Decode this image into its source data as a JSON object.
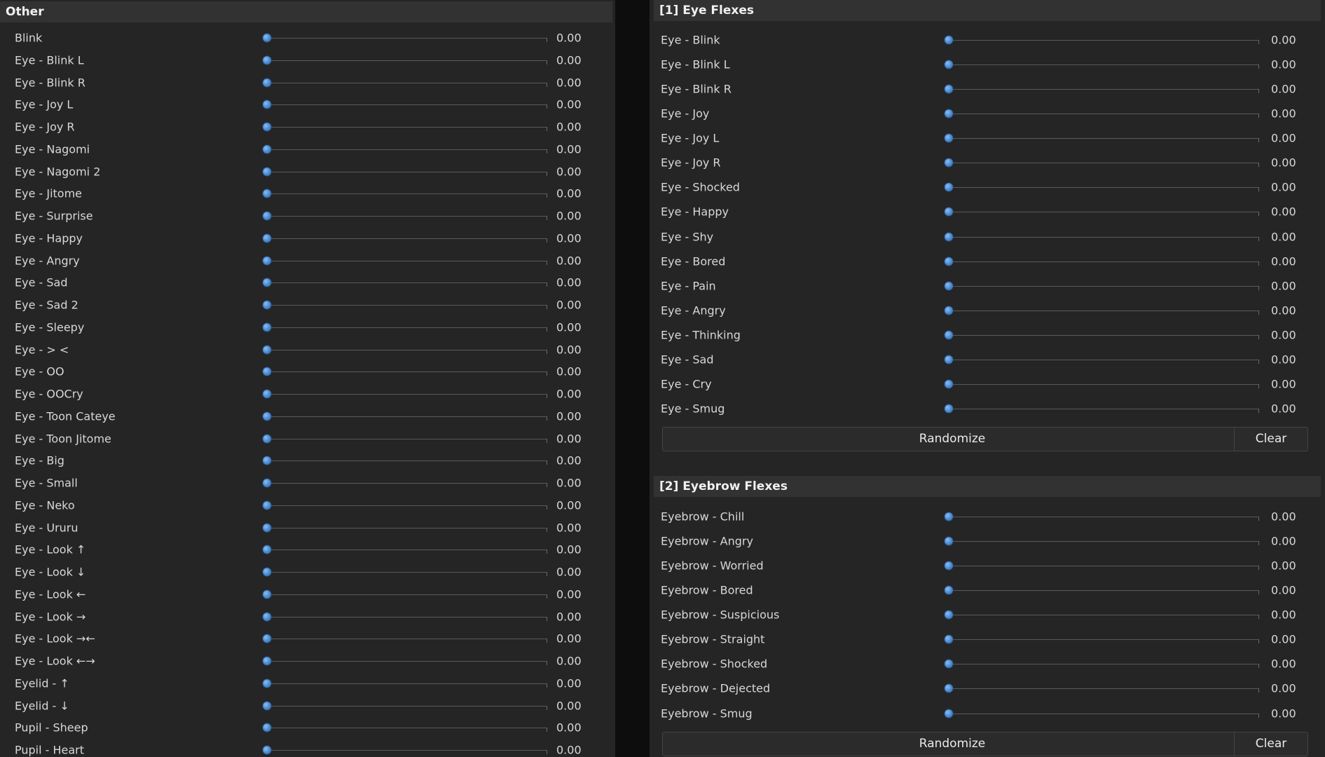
{
  "other": {
    "title": "Other",
    "sliders": [
      {
        "label": "Blink",
        "value": "0.00",
        "level": 0
      },
      {
        "label": "Eye - Blink L",
        "value": "0.00",
        "level": 0
      },
      {
        "label": "Eye - Blink R",
        "value": "0.00",
        "level": 0
      },
      {
        "label": "Eye - Joy L",
        "value": "0.00",
        "level": 0
      },
      {
        "label": "Eye - Joy R",
        "value": "0.00",
        "level": 0
      },
      {
        "label": "Eye - Nagomi",
        "value": "0.00",
        "level": 0
      },
      {
        "label": "Eye - Nagomi 2",
        "value": "0.00",
        "level": 0
      },
      {
        "label": "Eye - Jitome",
        "value": "0.00",
        "level": 0
      },
      {
        "label": "Eye - Surprise",
        "value": "0.00",
        "level": 0
      },
      {
        "label": "Eye - Happy",
        "value": "0.00",
        "level": 0
      },
      {
        "label": "Eye - Angry",
        "value": "0.00",
        "level": 0
      },
      {
        "label": "Eye - Sad",
        "value": "0.00",
        "level": 0
      },
      {
        "label": "Eye - Sad 2",
        "value": "0.00",
        "level": 0
      },
      {
        "label": "Eye - Sleepy",
        "value": "0.00",
        "level": 0
      },
      {
        "label": "Eye - > <",
        "value": "0.00",
        "level": 0
      },
      {
        "label": "Eye - OO",
        "value": "0.00",
        "level": 0
      },
      {
        "label": "Eye - OOCry",
        "value": "0.00",
        "level": 0
      },
      {
        "label": "Eye - Toon Cateye",
        "value": "0.00",
        "level": 0
      },
      {
        "label": "Eye - Toon Jitome",
        "value": "0.00",
        "level": 0
      },
      {
        "label": "Eye - Big",
        "value": "0.00",
        "level": 0
      },
      {
        "label": "Eye - Small",
        "value": "0.00",
        "level": 0
      },
      {
        "label": "Eye - Neko",
        "value": "0.00",
        "level": 0
      },
      {
        "label": "Eye - Ururu",
        "value": "0.00",
        "level": 0
      },
      {
        "label": "Eye - Look ↑",
        "value": "0.00",
        "level": 0
      },
      {
        "label": "Eye - Look ↓",
        "value": "0.00",
        "level": 0
      },
      {
        "label": "Eye - Look ←",
        "value": "0.00",
        "level": 0
      },
      {
        "label": "Eye - Look →",
        "value": "0.00",
        "level": 0
      },
      {
        "label": "Eye - Look →←",
        "value": "0.00",
        "level": 0
      },
      {
        "label": "Eye - Look ←→",
        "value": "0.00",
        "level": 0
      },
      {
        "label": "Eyelid - ↑",
        "value": "0.00",
        "level": 0
      },
      {
        "label": "Eyelid - ↓",
        "value": "0.00",
        "level": 0
      },
      {
        "label": "Pupil - Sheep",
        "value": "0.00",
        "level": 0
      },
      {
        "label": "Pupil - Heart",
        "value": "0.00",
        "level": 0
      }
    ]
  },
  "eye_flexes": {
    "title": "[1] Eye Flexes",
    "sliders": [
      {
        "label": "Eye - Blink",
        "value": "0.00",
        "level": 0
      },
      {
        "label": "Eye - Blink L",
        "value": "0.00",
        "level": 0
      },
      {
        "label": "Eye - Blink R",
        "value": "0.00",
        "level": 0
      },
      {
        "label": "Eye - Joy",
        "value": "0.00",
        "level": 0
      },
      {
        "label": "Eye - Joy L",
        "value": "0.00",
        "level": 0
      },
      {
        "label": "Eye - Joy R",
        "value": "0.00",
        "level": 0
      },
      {
        "label": "Eye - Shocked",
        "value": "0.00",
        "level": 0
      },
      {
        "label": "Eye - Happy",
        "value": "0.00",
        "level": 0
      },
      {
        "label": "Eye - Shy",
        "value": "0.00",
        "level": 0
      },
      {
        "label": "Eye - Bored",
        "value": "0.00",
        "level": 0
      },
      {
        "label": "Eye - Pain",
        "value": "0.00",
        "level": 0
      },
      {
        "label": "Eye - Angry",
        "value": "0.00",
        "level": 0
      },
      {
        "label": "Eye - Thinking",
        "value": "0.00",
        "level": 0
      },
      {
        "label": "Eye - Sad",
        "value": "0.00",
        "level": 0
      },
      {
        "label": "Eye - Cry",
        "value": "0.00",
        "level": 0
      },
      {
        "label": "Eye - Smug",
        "value": "0.00",
        "level": 0
      }
    ],
    "randomize_label": "Randomize",
    "clear_label": "Clear"
  },
  "eyebrow_flexes": {
    "title": "[2] Eyebrow Flexes",
    "sliders": [
      {
        "label": "Eyebrow - Chill",
        "value": "0.00",
        "level": 0
      },
      {
        "label": "Eyebrow - Angry",
        "value": "0.00",
        "level": 0
      },
      {
        "label": "Eyebrow - Worried",
        "value": "0.00",
        "level": 0
      },
      {
        "label": "Eyebrow - Bored",
        "value": "0.00",
        "level": 0
      },
      {
        "label": "Eyebrow - Suspicious",
        "value": "0.00",
        "level": 0
      },
      {
        "label": "Eyebrow - Straight",
        "value": "0.00",
        "level": 0
      },
      {
        "label": "Eyebrow - Shocked",
        "value": "0.00",
        "level": 0
      },
      {
        "label": "Eyebrow - Dejected",
        "value": "0.00",
        "level": 0
      },
      {
        "label": "Eyebrow - Smug",
        "value": "0.00",
        "level": 0
      }
    ],
    "randomize_label": "Randomize",
    "clear_label": "Clear"
  },
  "colors": {
    "background": "#0d0d0d",
    "panel": "#252525",
    "header": "#323232",
    "accent": "#4a8ad0"
  }
}
